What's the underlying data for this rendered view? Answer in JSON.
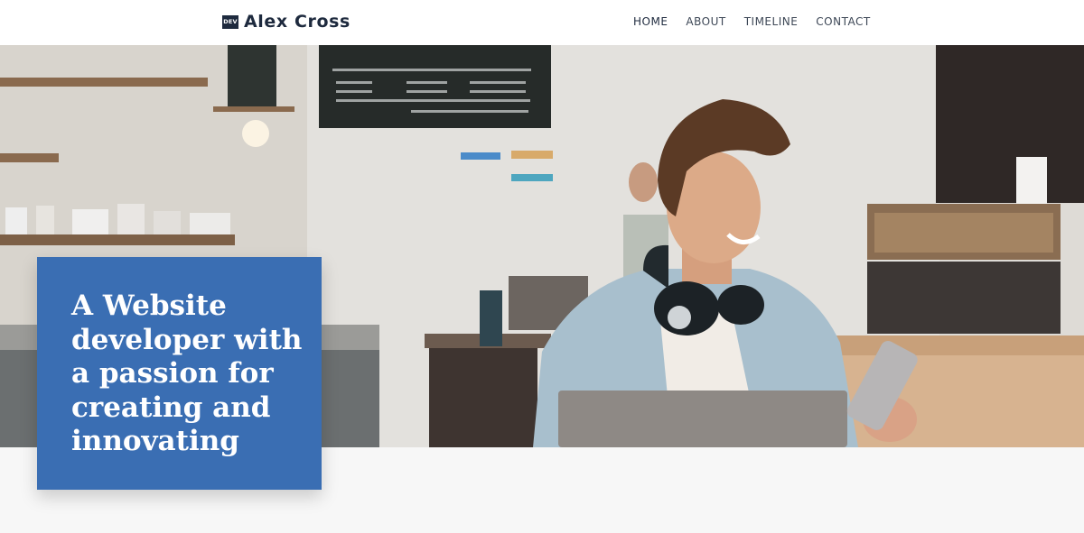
{
  "header": {
    "brand_badge": "DEV",
    "brand_name": "Alex Cross",
    "nav": [
      {
        "label": "HOME",
        "active": true
      },
      {
        "label": "ABOUT",
        "active": false
      },
      {
        "label": "TIMELINE",
        "active": false
      },
      {
        "label": "CONTACT",
        "active": false
      }
    ]
  },
  "hero": {
    "title": "A Website developer with a passion for creating and innovating"
  },
  "colors": {
    "accent": "#3a6eb3",
    "brand_dark": "#1e2a3e",
    "page_bg": "#f7f7f7"
  }
}
